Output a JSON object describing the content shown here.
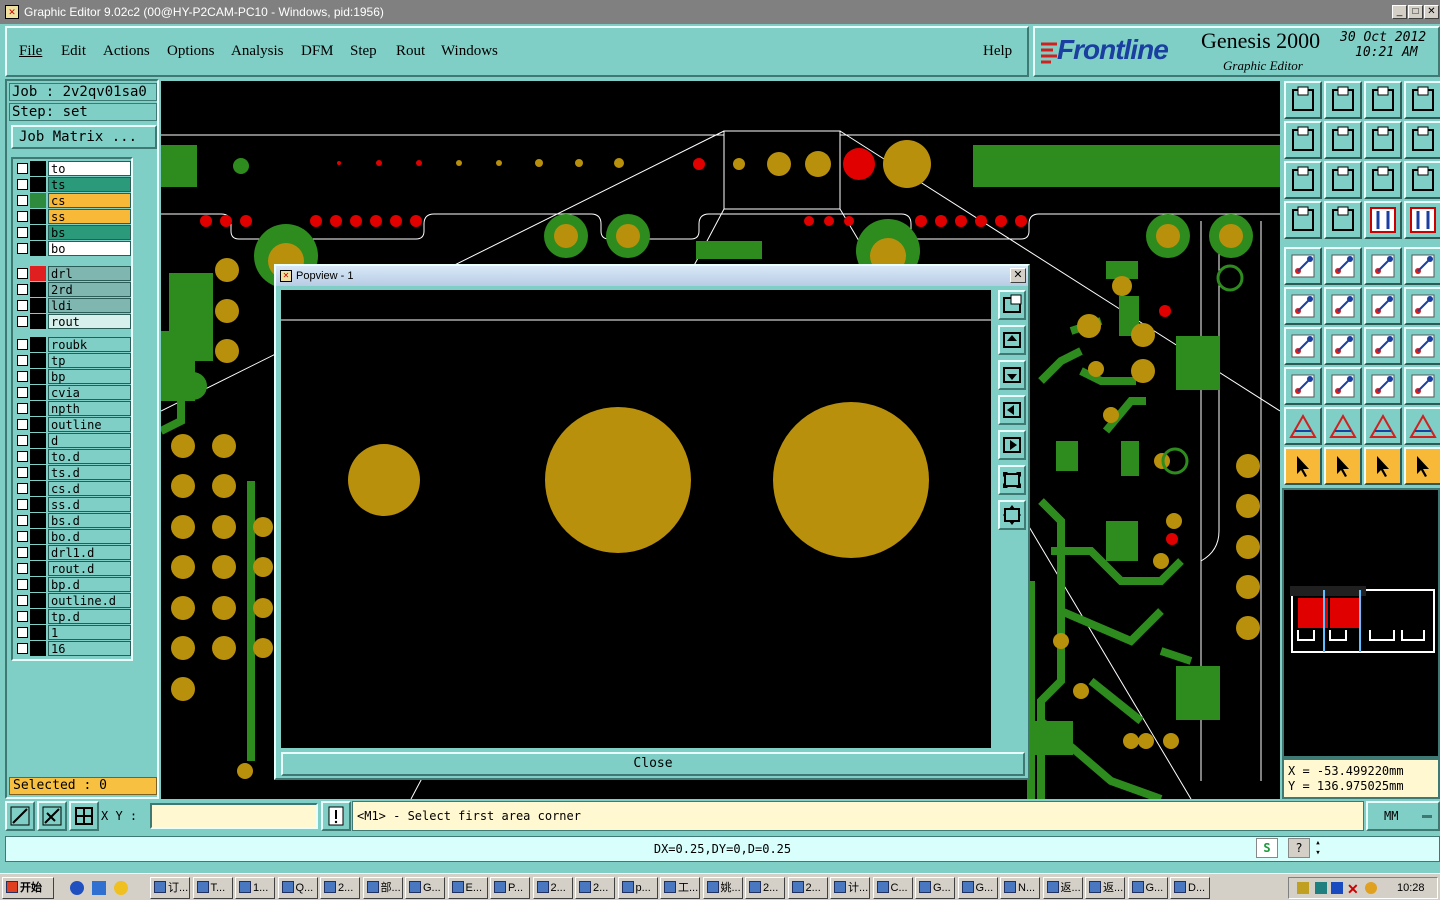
{
  "window": {
    "title": "Graphic Editor 9.02c2 (00@HY-P2CAM-PC10 - Windows, pid:1956)",
    "minimize": "_",
    "restore": "□",
    "close": "✕"
  },
  "menu": {
    "items": [
      "File",
      "Edit",
      "Actions",
      "Options",
      "Analysis",
      "DFM",
      "Step",
      "Rout",
      "Windows"
    ],
    "help": "Help"
  },
  "brand": {
    "logo": "Frontline",
    "product": "Genesis 2000",
    "subtitle": "Graphic Editor",
    "date": "30 Oct 2012",
    "time": "10:21 AM"
  },
  "job": {
    "job_label": "Job : 2v2qv01sa0",
    "step_label": "Step: set",
    "matrix_button": "Job Matrix ..."
  },
  "layers": [
    {
      "name": "to",
      "color": "#ffffff",
      "marker": "#000000"
    },
    {
      "name": "ts",
      "color": "#2a9a7a",
      "marker": "#000000"
    },
    {
      "name": "cs",
      "color": "#f8b838",
      "marker": "#2e8b3e"
    },
    {
      "name": "ss",
      "color": "#f8b838",
      "marker": "#000000"
    },
    {
      "name": "bs",
      "color": "#2a9a7a",
      "marker": "#000000"
    },
    {
      "name": "bo",
      "color": "#ffffff",
      "marker": "#000000"
    },
    {
      "name": "drl",
      "color": "#7fb6b0",
      "marker": "#e02020"
    },
    {
      "name": "2rd",
      "color": "#7fb6b0",
      "marker": "#000000"
    },
    {
      "name": "ldi",
      "color": "#7fb6b0",
      "marker": "#000000"
    },
    {
      "name": "rout",
      "color": "#d8f0ec",
      "marker": "#000000"
    },
    {
      "name": "roubk",
      "color": "#7fcfc6",
      "marker": "#000000"
    },
    {
      "name": "tp",
      "color": "#7fcfc6",
      "marker": "#000000"
    },
    {
      "name": "bp",
      "color": "#7fcfc6",
      "marker": "#000000"
    },
    {
      "name": "cvia",
      "color": "#7fcfc6",
      "marker": "#000000"
    },
    {
      "name": "npth",
      "color": "#7fcfc6",
      "marker": "#000000"
    },
    {
      "name": "outline",
      "color": "#7fcfc6",
      "marker": "#000000"
    },
    {
      "name": "d",
      "color": "#7fcfc6",
      "marker": "#000000"
    },
    {
      "name": "to.d",
      "color": "#7fcfc6",
      "marker": "#000000"
    },
    {
      "name": "ts.d",
      "color": "#7fcfc6",
      "marker": "#000000"
    },
    {
      "name": "cs.d",
      "color": "#7fcfc6",
      "marker": "#000000"
    },
    {
      "name": "ss.d",
      "color": "#7fcfc6",
      "marker": "#000000"
    },
    {
      "name": "bs.d",
      "color": "#7fcfc6",
      "marker": "#000000"
    },
    {
      "name": "bo.d",
      "color": "#7fcfc6",
      "marker": "#000000"
    },
    {
      "name": "drl1.d",
      "color": "#7fcfc6",
      "marker": "#000000"
    },
    {
      "name": "rout.d",
      "color": "#7fcfc6",
      "marker": "#000000"
    },
    {
      "name": "bp.d",
      "color": "#7fcfc6",
      "marker": "#000000"
    },
    {
      "name": "outline.d",
      "color": "#7fcfc6",
      "marker": "#000000"
    },
    {
      "name": "tp.d",
      "color": "#7fcfc6",
      "marker": "#000000"
    },
    {
      "name": "1",
      "color": "#7fcfc6",
      "marker": "#000000"
    },
    {
      "name": "16",
      "color": "#7fcfc6",
      "marker": "#000000"
    }
  ],
  "selected": "Selected : 0",
  "popview": {
    "title": "Popview - 1",
    "close_button": "Close",
    "tool_icons": [
      "zoom-window-icon",
      "pan-up-icon",
      "pan-down-icon",
      "pan-left-icon",
      "pan-right-icon",
      "zoom-fit-icon",
      "zoom-home-icon"
    ]
  },
  "coords": {
    "x": "X = -53.499220mm",
    "y": "Y = 136.975025mm"
  },
  "command": {
    "xy_label": "X Y :",
    "xy_value": "",
    "prompt": "<M1> - Select first area corner",
    "unit": "MM",
    "status": "DX=0.25,DY=0,D=0.25"
  },
  "taskbar": {
    "start": "开始",
    "tasks": [
      "订...",
      "T...",
      "1...",
      "Q...",
      "2...",
      "部...",
      "G...",
      "E...",
      "P...",
      "2...",
      "2...",
      "p...",
      "工...",
      "姚...",
      "2...",
      "2...",
      "计...",
      "C...",
      "G...",
      "G...",
      "N...",
      "返...",
      "返...",
      "G...",
      "D..."
    ],
    "clock": "10:28"
  },
  "colors": {
    "panel": "#7fcfc6",
    "copper": "#2e8b1e",
    "pad": "#b8900c",
    "drill": "#e00000",
    "selected_bg": "#f8b838"
  }
}
